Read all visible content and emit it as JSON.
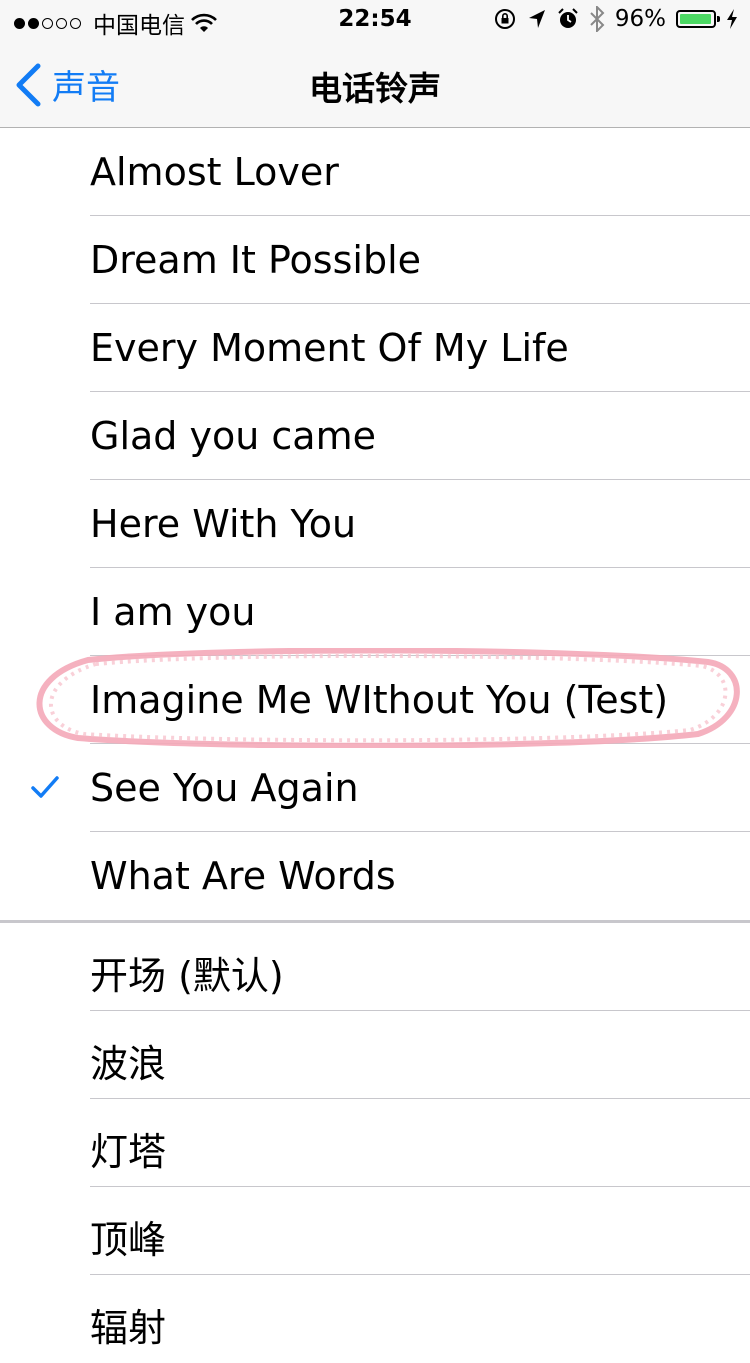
{
  "status_bar": {
    "carrier": "中国电信",
    "time": "22:54",
    "battery": "96%",
    "battery_level": 0.96,
    "icons": [
      "signal-dots",
      "wifi-icon",
      "orientation-lock-icon",
      "location-arrow-icon",
      "alarm-icon",
      "bluetooth-icon",
      "battery-icon",
      "charging-bolt-icon"
    ]
  },
  "nav": {
    "back_label": "声音",
    "title": "电话铃声"
  },
  "ringtones": [
    {
      "label": "Almost Lover",
      "selected": false
    },
    {
      "label": "Dream It Possible",
      "selected": false
    },
    {
      "label": "Every Moment Of My Life",
      "selected": false
    },
    {
      "label": "Glad you came",
      "selected": false
    },
    {
      "label": "Here With You",
      "selected": false
    },
    {
      "label": "I am you",
      "selected": false
    },
    {
      "label": "Imagine Me WIthout You (Test)",
      "selected": false,
      "annotated": true
    },
    {
      "label": "See You Again",
      "selected": true
    },
    {
      "label": "What Are Words",
      "selected": false
    }
  ],
  "system_ringtones": [
    {
      "label": "开场 (默认)"
    },
    {
      "label": "波浪"
    },
    {
      "label": "灯塔"
    },
    {
      "label": "顶峰"
    },
    {
      "label": "辐射"
    }
  ],
  "colors": {
    "accent": "#127cf5",
    "annotation": "#f4a9b8",
    "separator": "#c8c7cc",
    "battery": "#4cd964"
  }
}
